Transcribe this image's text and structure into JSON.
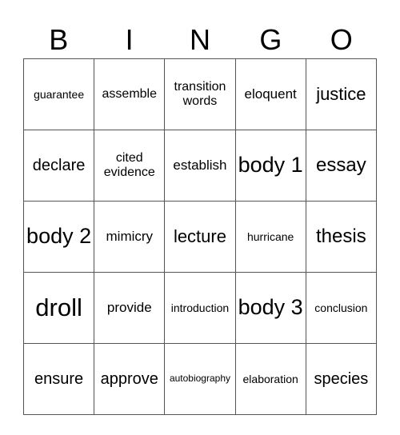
{
  "header": [
    "B",
    "I",
    "N",
    "G",
    "O"
  ],
  "rows": [
    [
      {
        "text": "guarantee",
        "size": "s2"
      },
      {
        "text": "assemble",
        "size": "s3"
      },
      {
        "text": "transition words",
        "size": "s3"
      },
      {
        "text": "eloquent",
        "size": "s4"
      },
      {
        "text": "justice",
        "size": "s6"
      }
    ],
    [
      {
        "text": "declare",
        "size": "s5"
      },
      {
        "text": "cited evidence",
        "size": "s3"
      },
      {
        "text": "establish",
        "size": "s4"
      },
      {
        "text": "body 1",
        "size": "s8"
      },
      {
        "text": "essay",
        "size": "s7"
      }
    ],
    [
      {
        "text": "body 2",
        "size": "s8"
      },
      {
        "text": "mimicry",
        "size": "s4"
      },
      {
        "text": "lecture",
        "size": "s6"
      },
      {
        "text": "hurricane",
        "size": "s2"
      },
      {
        "text": "thesis",
        "size": "s7"
      }
    ],
    [
      {
        "text": "droll",
        "size": "s9"
      },
      {
        "text": "provide",
        "size": "s4"
      },
      {
        "text": "introduction",
        "size": "s2"
      },
      {
        "text": "body 3",
        "size": "s8"
      },
      {
        "text": "conclusion",
        "size": "s2"
      }
    ],
    [
      {
        "text": "ensure",
        "size": "s5"
      },
      {
        "text": "approve",
        "size": "s5"
      },
      {
        "text": "autobiography",
        "size": "s1"
      },
      {
        "text": "elaboration",
        "size": "s2"
      },
      {
        "text": "species",
        "size": "s5"
      }
    ]
  ]
}
